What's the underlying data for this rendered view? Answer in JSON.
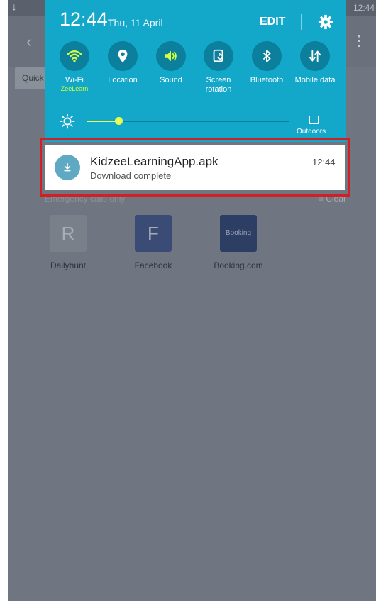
{
  "status_bar": {
    "clock": "12:44"
  },
  "background": {
    "tab_label": "Quick",
    "emergency_text": "Emergency calls only",
    "clear_label": "Clear",
    "apps": [
      {
        "letter": "R",
        "name": "Dailyhunt",
        "tile_color": "#7a808a"
      },
      {
        "letter": "F",
        "name": "Facebook",
        "tile_color": "#3a4c75"
      },
      {
        "letter": "Booking",
        "name": "Booking.com",
        "tile_color": "#2c3e63"
      }
    ]
  },
  "panel": {
    "time": "12:44",
    "date": "Thu, 11 April",
    "edit_label": "EDIT",
    "accent_color": "#13a7c9",
    "quick_settings": [
      {
        "icon": "wifi-icon",
        "label": "Wi-Fi",
        "sublabel": "ZeeLearn",
        "active": true
      },
      {
        "icon": "location-icon",
        "label": "Location",
        "active": false
      },
      {
        "icon": "sound-icon",
        "label": "Sound",
        "active": true
      },
      {
        "icon": "screen-rotation-icon",
        "label": "Screen rotation",
        "active": false
      },
      {
        "icon": "bluetooth-icon",
        "label": "Bluetooth",
        "active": false
      },
      {
        "icon": "mobile-data-icon",
        "label": "Mobile data",
        "active": false
      }
    ],
    "brightness": {
      "level": 0.16,
      "outdoors_label": "Outdoors"
    }
  },
  "notification": {
    "title": "KidzeeLearningApp.apk",
    "subtitle": "Download complete",
    "time": "12:44",
    "icon": "download-icon"
  }
}
